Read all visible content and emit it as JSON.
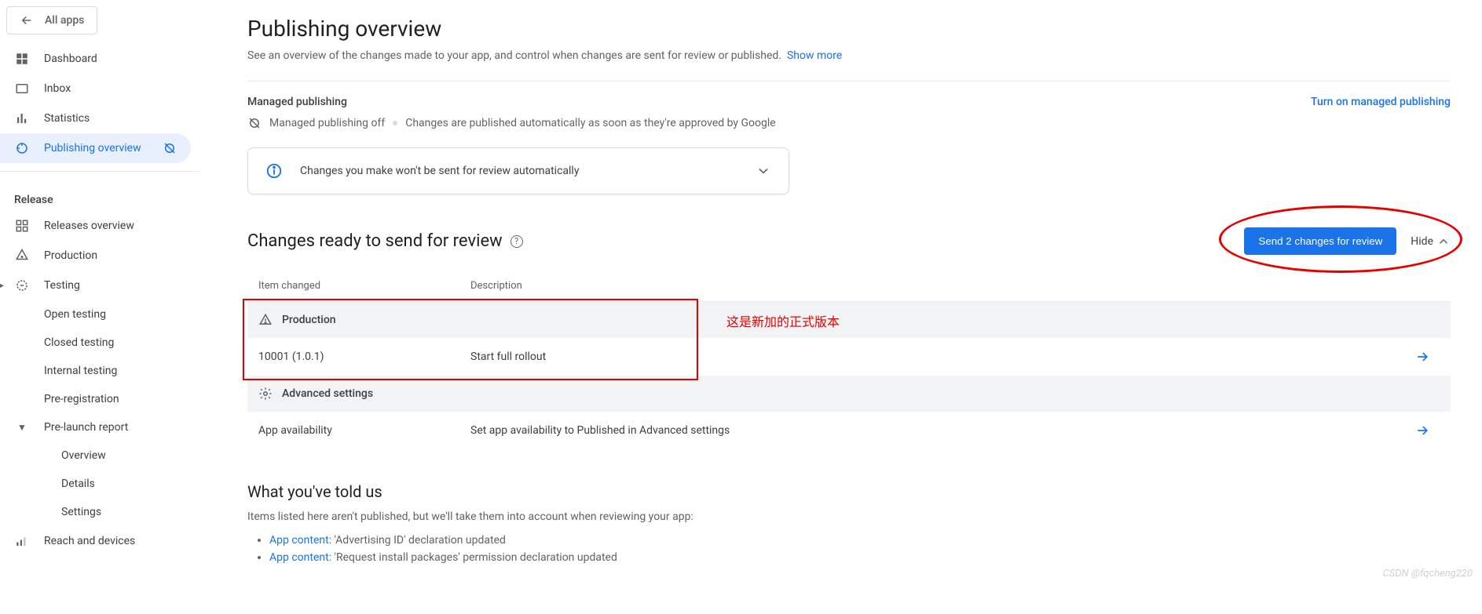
{
  "nav": {
    "allApps": "All apps",
    "dashboard": "Dashboard",
    "inbox": "Inbox",
    "statistics": "Statistics",
    "publishingOverview": "Publishing overview",
    "releaseHeader": "Release",
    "releasesOverview": "Releases overview",
    "production": "Production",
    "testing": "Testing",
    "openTesting": "Open testing",
    "closedTesting": "Closed testing",
    "internalTesting": "Internal testing",
    "preRegistration": "Pre-registration",
    "preLaunchReport": "Pre-launch report",
    "plrOverview": "Overview",
    "plrDetails": "Details",
    "plrSettings": "Settings",
    "reachDevices": "Reach and devices"
  },
  "main": {
    "title": "Publishing overview",
    "subtitle": "See an overview of the changes made to your app, and control when changes are sent for review or published.",
    "showMore": "Show more",
    "managedPublishing": "Managed publishing",
    "turnOn": "Turn on managed publishing",
    "mpOff": "Managed publishing off",
    "mpAuto": "Changes are published automatically as soon as they're approved by Google",
    "infoCard": "Changes you make won't be sent for review automatically",
    "changesTitle": "Changes ready to send for review",
    "sendBtn": "Send 2 changes for review",
    "hide": "Hide",
    "colItem": "Item changed",
    "colDesc": "Description",
    "grpProduction": "Production",
    "row1Item": "10001 (1.0.1)",
    "row1Desc": "Start full rollout",
    "grpAdvanced": "Advanced settings",
    "row2Item": "App availability",
    "row2Desc": "Set app availability to Published in Advanced settings",
    "toldTitle": "What you've told us",
    "toldSub": "Items listed here aren't published, but we'll take them into account when reviewing your app:",
    "appContent": "App content",
    "told1": ": 'Advertising ID' declaration updated",
    "told2": ": 'Request install packages' permission declaration updated"
  },
  "annotation": "这是新加的正式版本",
  "watermark": "CSDN @fqcheng220"
}
